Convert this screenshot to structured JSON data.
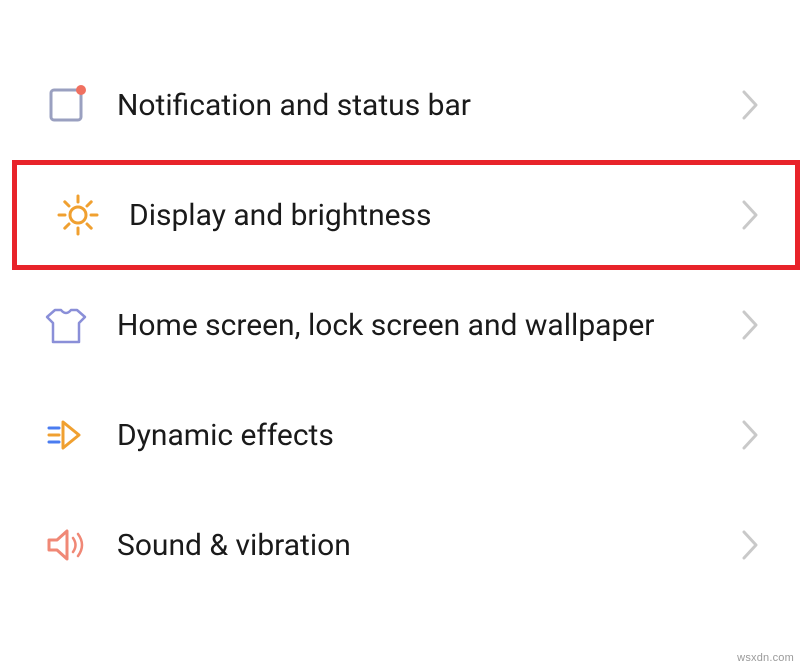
{
  "settings": {
    "items": [
      {
        "label": "Notification and status bar"
      },
      {
        "label": "Display and brightness"
      },
      {
        "label": "Home screen, lock screen and wallpaper"
      },
      {
        "label": "Dynamic effects"
      },
      {
        "label": "Sound & vibration"
      }
    ]
  },
  "watermark": "wsxdn.com"
}
